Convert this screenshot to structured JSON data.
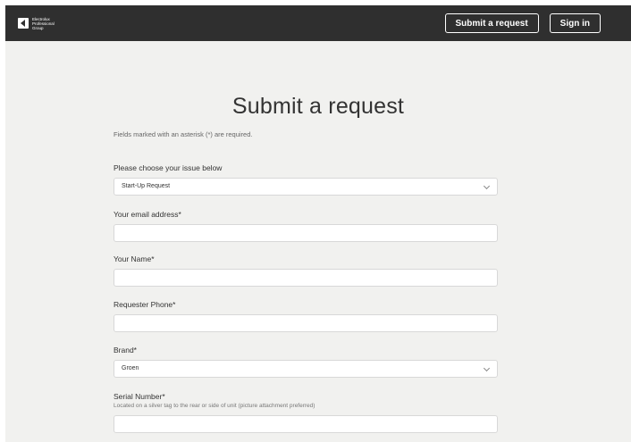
{
  "header": {
    "logo_text": "Electrolux Professional Group",
    "submit_request_label": "Submit a request",
    "sign_in_label": "Sign in"
  },
  "page": {
    "title": "Submit a request",
    "required_note": "Fields marked with an asterisk (*) are required."
  },
  "form": {
    "issue_label": "Please choose your issue below",
    "issue_value": "Start-Up Request",
    "email_label": "Your email address*",
    "email_value": "",
    "name_label": "Your Name*",
    "name_value": "",
    "phone_label": "Requester Phone*",
    "phone_value": "",
    "brand_label": "Brand*",
    "brand_value": "Groen",
    "serial_label": "Serial Number*",
    "serial_hint": "Located on a silver tag to the rear or side of unit (picture attachment preferred)",
    "serial_value": ""
  },
  "colors": {
    "header_bg": "#2f2f2f",
    "page_bg": "#f1f1ef",
    "field_border": "#d8d8d8"
  }
}
